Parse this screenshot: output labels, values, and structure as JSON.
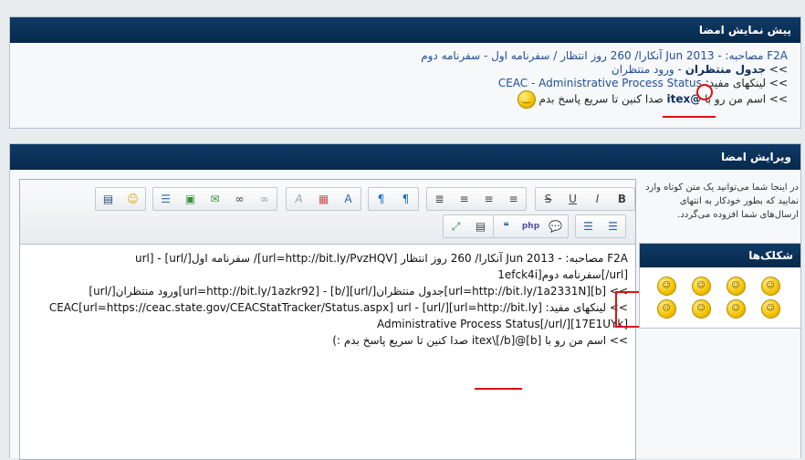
{
  "preview": {
    "title": "پیش نمایش امضا",
    "line1": "F2A مصاحبه: - Jun 2013 آنکارا/ 260 روز انتظار / سفرنامه اول - سفرنامه دوم",
    "line2_prefix": ">>",
    "line2_bold": "جدول منتظران",
    "line2_rest": "- ورود منتظران",
    "line3_prefix": ">> لینکهای مفید:",
    "line3_link": "CEAC - Administrative Process Status",
    "line4_prefix": ">> اسم من رو با",
    "line4_handle": "@itex",
    "line4_rest": "صدا کنین تا سریع پاسخ بدم"
  },
  "editor": {
    "title": "ویرایش امضا",
    "content": [
      "F2A مصاحبه: - Jun 2013 آنکارا/ 260 روز انتظار [url=http://bit.ly/PvzHQV]/ سفرنامه اول[/url] - [url",
      "[url/]سفرنامه دوم[1efck4i",
      ">> [b][url=http://bit.ly/1a2331N]جدول منتظران[/url][/b] - [url=http://bit.ly/1azkr92]ورود منتظران[/url]",
      ">> لینکهای مفید: [url=http://bit.ly][/url] - CEAC[url=https://ceac.state.gov/CEACStatTracker/Status.aspx] url",
      "[17E1UYk]Administrative Process Status[/url/]",
      ">> اسم من رو با [b]@itex\\[/b] صدا کنین تا سریع پاسخ بدم :)"
    ]
  },
  "sidebar": {
    "description": "در اینجا شما می‌توانید یک متن کوتاه وارد نمایید که بطور خودکار به انتهای ارسال‌های شما افزوده می‌گردد.",
    "smilies_title": "شکلک‌ها",
    "smilies": [
      "☺",
      "☺",
      "☺",
      "☺",
      "☹",
      "☺",
      "☺",
      "☺"
    ]
  },
  "toolbar": {
    "row1": [
      {
        "name": "bold-button",
        "glyph": "B"
      },
      {
        "name": "italic-button",
        "glyph": "I"
      },
      {
        "name": "underline-button",
        "glyph": "U"
      },
      {
        "name": "strike-button",
        "glyph": "S"
      },
      {
        "name": "justify-button",
        "glyph": "≣"
      },
      {
        "name": "align-right-button",
        "glyph": "≡"
      },
      {
        "name": "align-center-button",
        "glyph": "≡"
      },
      {
        "name": "align-left-button",
        "glyph": "≡"
      },
      {
        "name": "ltr-button",
        "glyph": "¶"
      },
      {
        "name": "rtl-button",
        "glyph": "¶"
      },
      {
        "name": "font-size-button",
        "glyph": "A"
      },
      {
        "name": "color-button",
        "glyph": "▦"
      },
      {
        "name": "font-button",
        "glyph": "A"
      },
      {
        "name": "indent-button",
        "glyph": "☰"
      },
      {
        "name": "image-button",
        "glyph": "▣"
      },
      {
        "name": "email-button",
        "glyph": "✉"
      },
      {
        "name": "link-button",
        "glyph": "∞"
      },
      {
        "name": "unlink-button",
        "glyph": "∞"
      },
      {
        "name": "video-button",
        "glyph": "▤"
      },
      {
        "name": "smiley-button",
        "glyph": "☺"
      }
    ],
    "row2": [
      {
        "name": "numbered-list-button",
        "glyph": "☰"
      },
      {
        "name": "bullet-list-button",
        "glyph": "☰"
      },
      {
        "name": "quote-button",
        "glyph": "❝"
      },
      {
        "name": "php-button",
        "glyph": "php"
      },
      {
        "name": "comment-button",
        "glyph": "💬"
      },
      {
        "name": "resize-button",
        "glyph": "⤢"
      },
      {
        "name": "source-button",
        "glyph": "▤"
      }
    ]
  }
}
